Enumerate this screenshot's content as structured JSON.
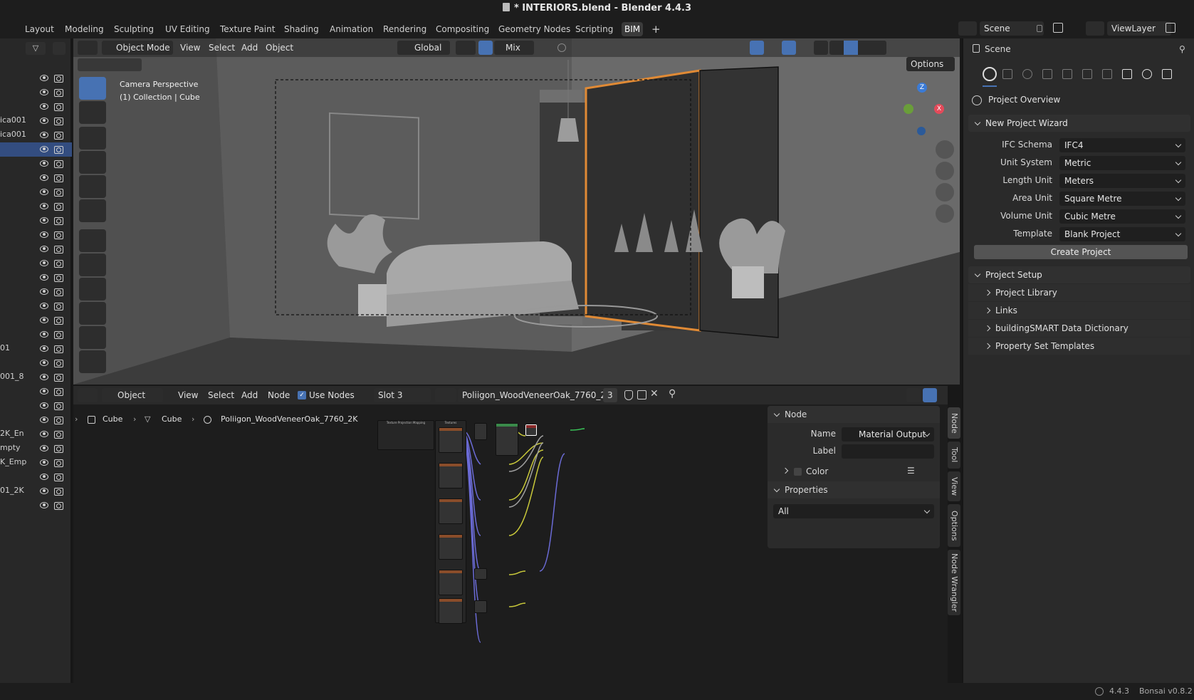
{
  "window": {
    "title": "* INTERIORS.blend - Blender 4.4.3"
  },
  "workspaces": [
    "Layout",
    "Modeling",
    "Sculpting",
    "UV Editing",
    "Texture Paint",
    "Shading",
    "Animation",
    "Rendering",
    "Compositing",
    "Geometry Nodes",
    "Scripting",
    "BIM"
  ],
  "active_workspace": "BIM",
  "top_right": {
    "scene": "Scene",
    "view_layer": "ViewLayer"
  },
  "outliner": {
    "rows": [
      "",
      "",
      "",
      "ica001",
      "ica001",
      "",
      "",
      "",
      "",
      "",
      "",
      "",
      "",
      "",
      "",
      "",
      "",
      "",
      "",
      "01",
      "",
      "001_8",
      "",
      "",
      "",
      "2K_En",
      "mpty",
      "K_Emp",
      "",
      "01_2K",
      ""
    ]
  },
  "viewport": {
    "mode": "Object Mode",
    "menus": [
      "View",
      "Select",
      "Add",
      "Object"
    ],
    "orientation": "Global",
    "snap_mode": "Mix",
    "options_label": "Options",
    "camera_label": "Camera Perspective",
    "collection_label": "(1) Collection | Cube",
    "gizmo": {
      "z": "Z",
      "x": "X"
    }
  },
  "node_editor": {
    "type": "Object",
    "menus": [
      "View",
      "Select",
      "Add",
      "Node"
    ],
    "use_nodes_label": "Use Nodes",
    "slot": "Slot 3",
    "material": "Poliigon_WoodVeneerOak_7760_2K",
    "users": "3",
    "breadcrumb": [
      "Cube",
      "Cube",
      "Poliigon_WoodVeneerOak_7760_2K"
    ],
    "node_titles": {
      "mapping": "Texture Projection Mapping",
      "textures": "Textures"
    }
  },
  "npanel": {
    "node_header": "Node",
    "name_label": "Name",
    "name_value": "Material Output",
    "label_label": "Label",
    "label_value": "",
    "color_label": "Color",
    "properties_header": "Properties",
    "properties_value": "All"
  },
  "sidetabs": [
    "Node",
    "Tool",
    "View",
    "Options",
    "Node Wrangler"
  ],
  "properties": {
    "scene_label": "Scene",
    "project_overview": "Project Overview",
    "wizard_header": "New Project Wizard",
    "fields": [
      {
        "label": "IFC Schema",
        "value": "IFC4"
      },
      {
        "label": "Unit System",
        "value": "Metric"
      },
      {
        "label": "Length Unit",
        "value": "Meters"
      },
      {
        "label": "Area Unit",
        "value": "Square Metre"
      },
      {
        "label": "Volume Unit",
        "value": "Cubic Metre"
      },
      {
        "label": "Template",
        "value": "Blank Project"
      }
    ],
    "create_button": "Create Project",
    "setup_header": "Project Setup",
    "setup_items": [
      "Project Library",
      "Links",
      "buildingSMART Data Dictionary",
      "Property Set Templates"
    ]
  },
  "status": {
    "version": "4.4.3",
    "addon": "Bonsai v0.8.2"
  },
  "colors": {
    "accent": "#4772b3",
    "selection": "#334d80",
    "axis_x": "#e44a5a",
    "axis_y": "#6a9e3a",
    "axis_z": "#3b7bd6",
    "highlight": "#e08a35"
  }
}
